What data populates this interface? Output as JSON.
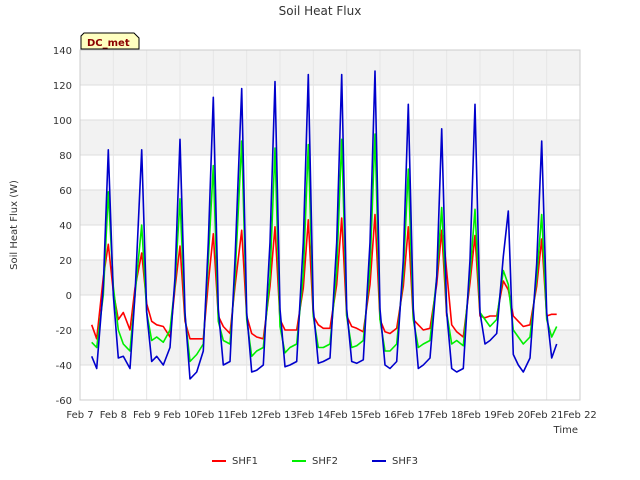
{
  "chart_data": {
    "type": "line",
    "title": "Soil Heat Flux",
    "xlabel": "Time",
    "ylabel": "Soil Heat Flux (W)",
    "site_tag": "DC_met",
    "ylim": [
      -60,
      140
    ],
    "yticks": [
      -60,
      -40,
      -20,
      0,
      20,
      40,
      60,
      80,
      100,
      120,
      140
    ],
    "xlim": [
      7,
      22
    ],
    "xticks": [
      7,
      8,
      9,
      10,
      11,
      12,
      13,
      14,
      15,
      16,
      17,
      18,
      19,
      20,
      21,
      22
    ],
    "xtick_labels": [
      "Feb 7",
      "Feb 8",
      "Feb 9",
      "Feb 10",
      "Feb 11",
      "Feb 12",
      "Feb 13",
      "Feb 14",
      "Feb 15",
      "Feb 16",
      "Feb 17",
      "Feb 18",
      "Feb 19",
      "Feb 20",
      "Feb 21",
      "Feb 22"
    ],
    "grid": true,
    "legend_position": "bottom-center",
    "series": [
      {
        "name": "SHF1",
        "color": "#ff0000",
        "x": [
          7.35,
          7.5,
          7.7,
          7.85,
          8.0,
          8.15,
          8.3,
          8.5,
          8.65,
          8.85,
          9.0,
          9.15,
          9.3,
          9.5,
          9.7,
          9.85,
          10.0,
          10.15,
          10.3,
          10.5,
          10.7,
          10.85,
          11.0,
          11.15,
          11.3,
          11.5,
          11.65,
          11.85,
          12.0,
          12.15,
          12.3,
          12.5,
          12.7,
          12.85,
          13.0,
          13.15,
          13.3,
          13.5,
          13.7,
          13.85,
          14.0,
          14.15,
          14.3,
          14.5,
          14.7,
          14.85,
          15.0,
          15.15,
          15.3,
          15.5,
          15.7,
          15.85,
          16.0,
          16.15,
          16.3,
          16.5,
          16.7,
          16.85,
          17.0,
          17.15,
          17.3,
          17.5,
          17.7,
          17.85,
          18.0,
          17.9,
          18.15,
          18.3,
          18.5,
          18.7,
          18.85,
          19.0,
          19.15,
          19.3,
          19.5,
          19.7,
          19.85,
          20.0,
          20.15,
          20.3,
          20.5,
          20.7,
          20.85,
          21.0,
          21.15,
          21.3
        ],
        "y": [
          -17,
          -25,
          10,
          29,
          2,
          -14,
          -10,
          -20,
          4,
          24,
          -5,
          -15,
          -17,
          -18,
          -24,
          4,
          28,
          -15,
          -25,
          -25,
          -25,
          7,
          35,
          -12,
          -18,
          -22,
          5,
          37,
          -12,
          -22,
          -24,
          -25,
          5,
          39,
          -14,
          -20,
          -20,
          -20,
          4,
          43,
          -12,
          -17,
          -19,
          -19,
          6,
          44,
          -12,
          -18,
          -19,
          -21,
          6,
          46,
          -14,
          -21,
          -22,
          -19,
          5,
          39,
          -14,
          -17,
          -20,
          -19,
          6,
          37,
          -12,
          34,
          -17,
          -21,
          -24,
          7,
          34,
          -12,
          -13,
          -12,
          -12,
          8,
          3,
          -12,
          -15,
          -18,
          -17,
          5,
          32,
          -12,
          -11,
          -11
        ]
      },
      {
        "name": "SHF2",
        "color": "#00ee00",
        "x": [
          7.35,
          7.5,
          7.7,
          7.85,
          8.0,
          8.15,
          8.3,
          8.5,
          8.65,
          8.85,
          9.0,
          9.15,
          9.3,
          9.5,
          9.7,
          9.85,
          10.0,
          10.15,
          10.3,
          10.5,
          10.7,
          10.85,
          11.0,
          11.15,
          11.3,
          11.5,
          11.65,
          11.85,
          12.0,
          12.15,
          12.3,
          12.5,
          12.7,
          12.85,
          13.0,
          13.15,
          13.3,
          13.5,
          13.7,
          13.85,
          14.0,
          14.15,
          14.3,
          14.5,
          14.7,
          14.85,
          15.0,
          15.15,
          15.3,
          15.5,
          15.7,
          15.85,
          16.0,
          16.15,
          16.3,
          16.5,
          16.7,
          16.85,
          17.0,
          17.15,
          17.3,
          17.5,
          17.7,
          17.85,
          18.0,
          18.15,
          18.3,
          18.5,
          18.7,
          18.85,
          19.0,
          19.15,
          19.3,
          19.5,
          19.7,
          19.85,
          20.0,
          20.15,
          20.3,
          20.5,
          20.7,
          20.85,
          21.0,
          21.15,
          21.3
        ],
        "y": [
          -27,
          -30,
          0,
          59,
          5,
          -20,
          -28,
          -32,
          0,
          40,
          -10,
          -26,
          -24,
          -27,
          -20,
          6,
          55,
          -12,
          -38,
          -34,
          -28,
          20,
          74,
          -15,
          -26,
          -28,
          10,
          88,
          -14,
          -35,
          -32,
          -30,
          10,
          84,
          -18,
          -33,
          -30,
          -28,
          12,
          86,
          -12,
          -30,
          -30,
          -28,
          14,
          89,
          -12,
          -30,
          -29,
          -26,
          15,
          92,
          -14,
          -32,
          -32,
          -28,
          12,
          72,
          -14,
          -30,
          -28,
          -26,
          10,
          50,
          -10,
          -28,
          -26,
          -29,
          12,
          49,
          -10,
          -14,
          -18,
          -14,
          14,
          6,
          -20,
          -24,
          -28,
          -24,
          10,
          46,
          -14,
          -24,
          -18
        ]
      },
      {
        "name": "SHF3",
        "color": "#0000cc",
        "x": [
          7.35,
          7.5,
          7.7,
          7.85,
          8.0,
          8.15,
          8.3,
          8.5,
          8.65,
          8.85,
          9.0,
          9.15,
          9.3,
          9.5,
          9.7,
          9.85,
          10.0,
          10.15,
          10.3,
          10.5,
          10.7,
          10.85,
          11.0,
          11.15,
          11.3,
          11.5,
          11.65,
          11.85,
          12.0,
          12.15,
          12.3,
          12.5,
          12.7,
          12.85,
          13.0,
          13.15,
          13.3,
          13.5,
          13.7,
          13.85,
          14.0,
          14.15,
          14.3,
          14.5,
          14.7,
          14.85,
          15.0,
          15.15,
          15.3,
          15.5,
          15.7,
          15.85,
          16.0,
          16.15,
          16.3,
          16.5,
          16.7,
          16.85,
          17.0,
          17.15,
          17.3,
          17.5,
          17.7,
          17.85,
          18.0,
          18.15,
          18.3,
          18.5,
          18.7,
          18.85,
          19.0,
          19.15,
          19.3,
          19.5,
          19.7,
          19.85,
          20.0,
          20.15,
          20.3,
          20.5,
          20.7,
          20.85,
          21.0,
          21.15,
          21.3
        ],
        "y": [
          -35,
          -42,
          5,
          83,
          0,
          -36,
          -35,
          -42,
          0,
          83,
          -10,
          -38,
          -35,
          -40,
          -30,
          10,
          89,
          -10,
          -48,
          -44,
          -32,
          30,
          113,
          -8,
          -40,
          -38,
          20,
          118,
          -10,
          -44,
          -43,
          -40,
          30,
          122,
          -8,
          -41,
          -40,
          -38,
          30,
          126,
          -8,
          -39,
          -38,
          -36,
          30,
          126,
          -8,
          -38,
          -39,
          -37,
          30,
          128,
          -8,
          -40,
          -42,
          -38,
          20,
          109,
          -8,
          -42,
          -40,
          -36,
          10,
          95,
          -10,
          -42,
          -44,
          -42,
          20,
          109,
          -10,
          -28,
          -26,
          -22,
          22,
          48,
          -34,
          -40,
          -44,
          -36,
          18,
          88,
          -10,
          -36,
          -28
        ]
      }
    ]
  }
}
